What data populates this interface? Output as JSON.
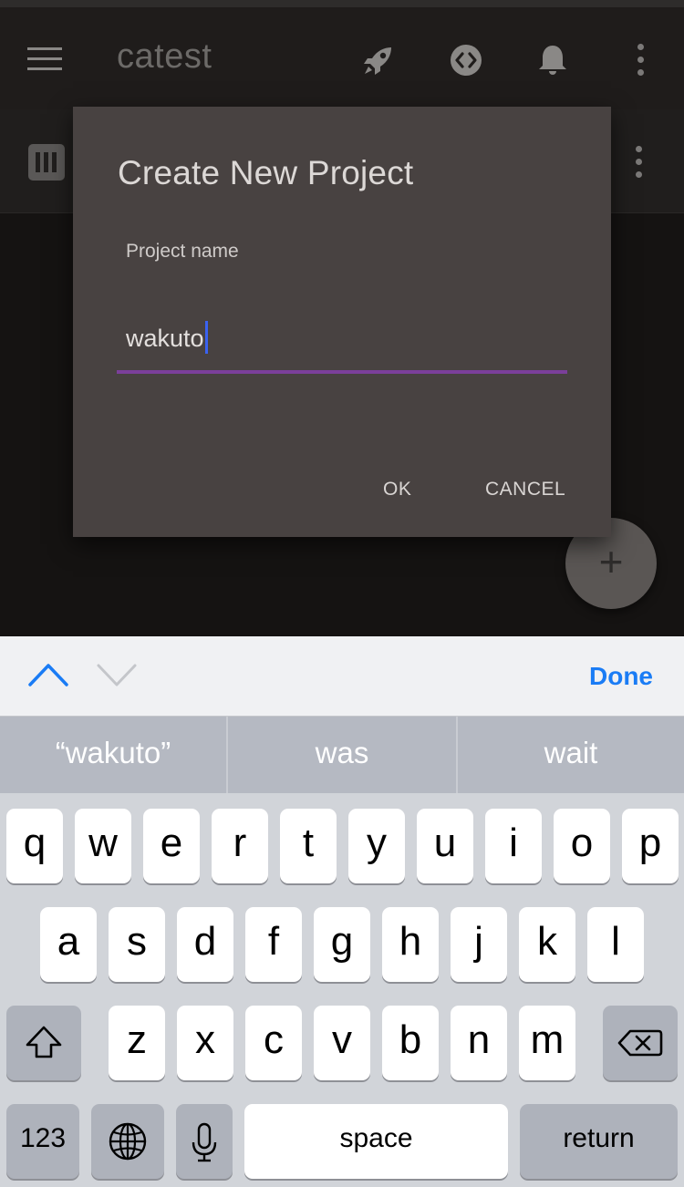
{
  "app": {
    "title": "catest"
  },
  "dialog": {
    "title": "Create New Project",
    "field_label": "Project name",
    "field_value": "wakuto",
    "ok_label": "OK",
    "cancel_label": "CANCEL"
  },
  "fab": {
    "label": "+"
  },
  "accessory": {
    "done_label": "Done"
  },
  "keyboard": {
    "suggestions": [
      "“wakuto”",
      "was",
      "wait"
    ],
    "row1": [
      "q",
      "w",
      "e",
      "r",
      "t",
      "y",
      "u",
      "i",
      "o",
      "p"
    ],
    "row2": [
      "a",
      "s",
      "d",
      "f",
      "g",
      "h",
      "j",
      "k",
      "l"
    ],
    "row3": [
      "z",
      "x",
      "c",
      "v",
      "b",
      "n",
      "m"
    ],
    "numbers_label": "123",
    "space_label": "space",
    "return_label": "return"
  },
  "colors": {
    "accent_underline": "#7b3f9a",
    "caret": "#3a62f0",
    "done_blue": "#1a7cf5",
    "dialog_bg": "#484241"
  },
  "icons": [
    "menu-icon",
    "rocket-icon",
    "code-icon",
    "bell-icon",
    "more-vert-icon",
    "board-icon",
    "plus-icon",
    "chevron-up-icon",
    "chevron-down-icon",
    "shift-icon",
    "delete-icon",
    "globe-icon",
    "mic-icon"
  ]
}
